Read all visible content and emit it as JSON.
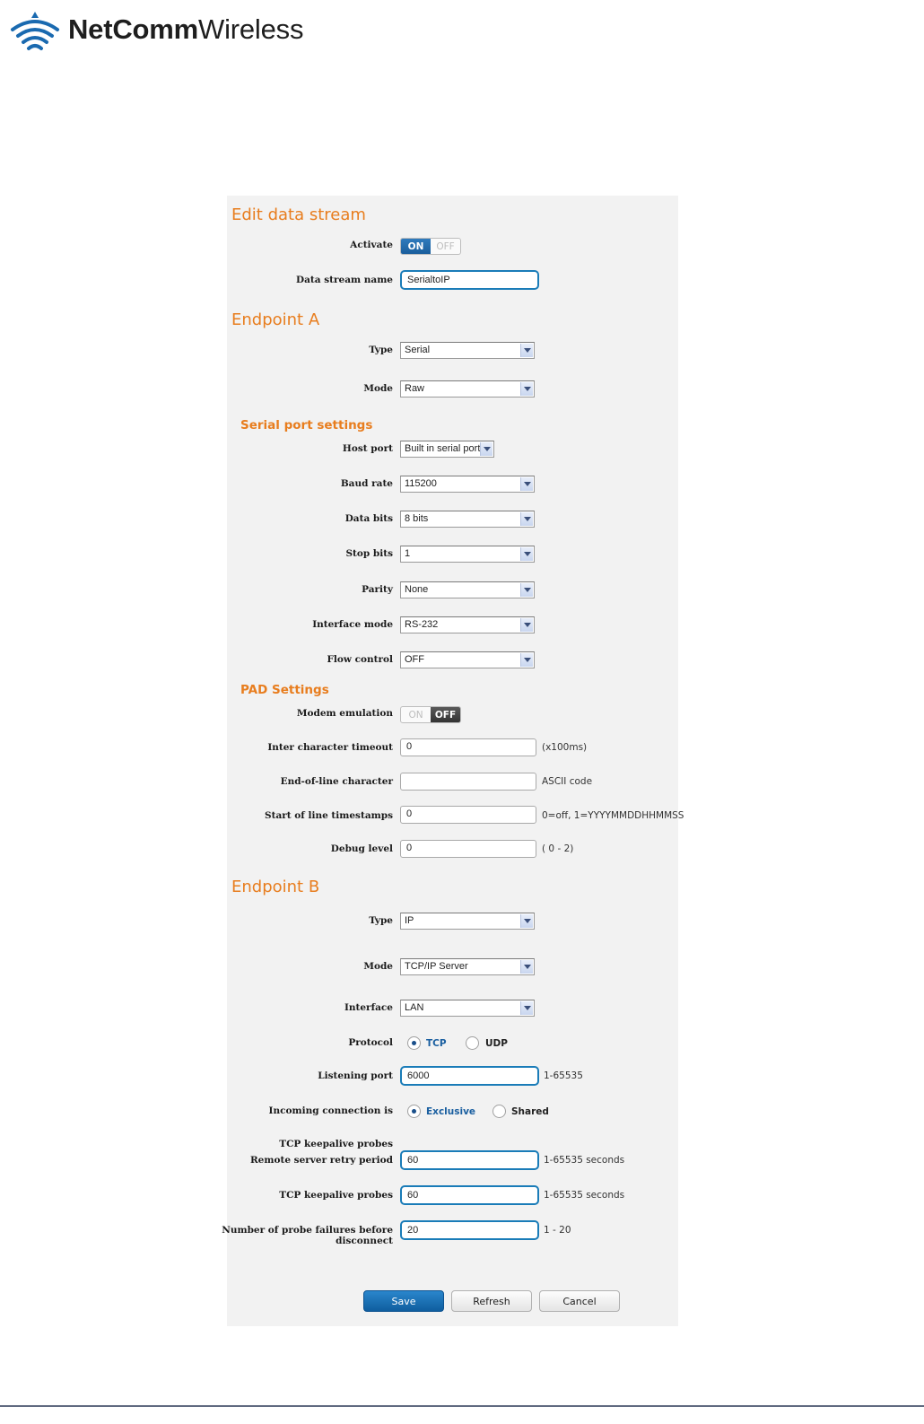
{
  "brand": {
    "name_bold": "NetComm",
    "name_light": "Wireless",
    "logo_icon": "wifi-signal-icon",
    "accent": "#1a6ab0"
  },
  "colors": {
    "section_title": "#e87d1e",
    "primary_button": "#1a6fb5",
    "panel_bg": "#f2f2f2"
  },
  "edit": {
    "title": "Edit data stream",
    "activate_label": "Activate",
    "activate_on": "ON",
    "activate_off": "OFF",
    "activate_state": "ON",
    "name_label": "Data stream name",
    "name_value": "SerialtoIP"
  },
  "endpoint_a": {
    "title": "Endpoint A",
    "type_label": "Type",
    "type_value": "Serial",
    "mode_label": "Mode",
    "mode_value": "Raw"
  },
  "serial": {
    "title": "Serial port settings",
    "host_port_label": "Host port",
    "host_port_value": "Built in serial port",
    "baud_label": "Baud rate",
    "baud_value": "115200",
    "data_bits_label": "Data bits",
    "data_bits_value": "8 bits",
    "stop_bits_label": "Stop bits",
    "stop_bits_value": "1",
    "parity_label": "Parity",
    "parity_value": "None",
    "interface_mode_label": "Interface mode",
    "interface_mode_value": "RS-232",
    "flow_label": "Flow control",
    "flow_value": "OFF"
  },
  "pad": {
    "title": "PAD Settings",
    "modem_label": "Modem emulation",
    "modem_on": "ON",
    "modem_off": "OFF",
    "modem_state": "OFF",
    "ict_label": "Inter character timeout",
    "ict_value": "0",
    "ict_hint": "(x100ms)",
    "eol_label": "End-of-line character",
    "eol_value": "",
    "eol_hint": "ASCII code",
    "sol_label": "Start of line timestamps",
    "sol_value": "0",
    "sol_hint": "0=off, 1=YYYYMMDDHHMMSS",
    "debug_label": "Debug level",
    "debug_value": "0",
    "debug_hint": "( 0 - 2)"
  },
  "endpoint_b": {
    "title": "Endpoint B",
    "type_label": "Type",
    "type_value": "IP",
    "mode_label": "Mode",
    "mode_value": "TCP/IP Server",
    "interface_label": "Interface",
    "interface_value": "LAN",
    "protocol_label": "Protocol",
    "protocol_tcp": "TCP",
    "protocol_udp": "UDP",
    "protocol_selected": "TCP",
    "listen_label": "Listening port",
    "listen_value": "6000",
    "listen_hint": "1-65535",
    "incoming_label": "Incoming connection is",
    "incoming_exclusive": "Exclusive",
    "incoming_shared": "Shared",
    "incoming_selected": "Exclusive",
    "keepalive_header": "TCP keepalive probes",
    "retry_label": "Remote server retry period",
    "retry_value": "60",
    "retry_hint": "1-65535 seconds",
    "keepalive_label": "TCP keepalive probes",
    "keepalive_value": "60",
    "keepalive_hint": "1-65535 seconds",
    "failures_label_1": "Number of probe failures before",
    "failures_label_2": "disconnect",
    "failures_value": "20",
    "failures_hint": "1 - 20"
  },
  "buttons": {
    "save": "Save",
    "refresh": "Refresh",
    "cancel": "Cancel"
  }
}
